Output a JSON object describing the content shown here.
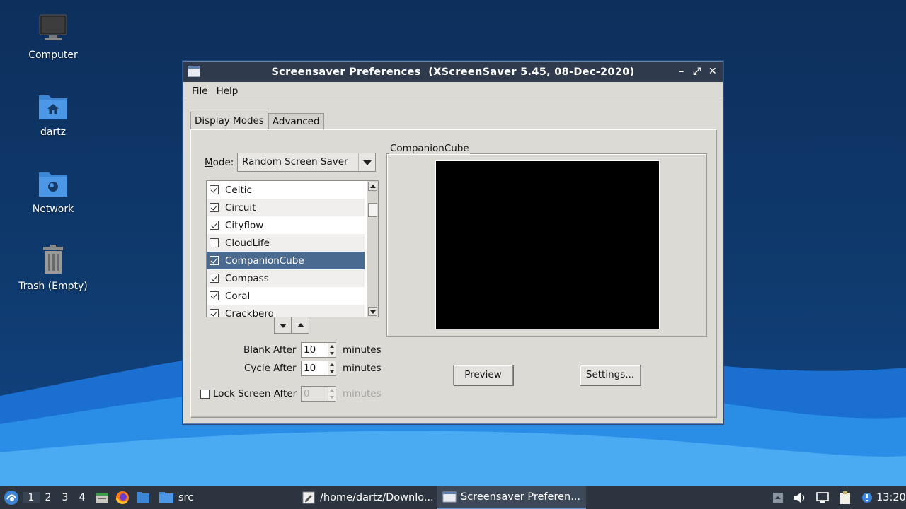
{
  "desktop": {
    "icons": [
      {
        "label": "Computer",
        "icon": "computer-icon"
      },
      {
        "label": "dartz",
        "icon": "home-folder-icon"
      },
      {
        "label": "Network",
        "icon": "network-folder-icon"
      },
      {
        "label": "Trash (Empty)",
        "icon": "trash-icon"
      }
    ]
  },
  "window": {
    "title": "Screensaver Preferences  (XScreenSaver 5.45, 08-Dec-2020)",
    "menu": [
      "File",
      "Help"
    ],
    "tabs": [
      "Display Modes",
      "Advanced"
    ],
    "mode": {
      "label": "Mode:",
      "value": "Random Screen Saver"
    },
    "savers": [
      {
        "name": "Celtic",
        "checked": true
      },
      {
        "name": "Circuit",
        "checked": true
      },
      {
        "name": "Cityflow",
        "checked": true
      },
      {
        "name": "CloudLife",
        "checked": false
      },
      {
        "name": "CompanionCube",
        "checked": true,
        "selected": true
      },
      {
        "name": "Compass",
        "checked": true
      },
      {
        "name": "Coral",
        "checked": true
      },
      {
        "name": "Crackberg",
        "checked": true
      }
    ],
    "blank_after": {
      "label": "Blank After",
      "value": "10",
      "unit": "minutes"
    },
    "cycle_after": {
      "label": "Cycle After",
      "value": "10",
      "unit": "minutes"
    },
    "lock_screen": {
      "label": "Lock Screen After",
      "value": "0",
      "unit": "minutes",
      "checked": false
    },
    "preview": {
      "title": "CompanionCube",
      "preview_button": "Preview",
      "settings_button": "Settings..."
    }
  },
  "taskbar": {
    "workspaces": [
      "1",
      "2",
      "3",
      "4"
    ],
    "active_workspace": "1",
    "quicklaunch": [
      "file-manager-icon",
      "firefox-icon",
      "folder-icon"
    ],
    "folder_label": "src",
    "tasks": [
      {
        "label": "/home/dartz/Downlo...",
        "active": false
      },
      {
        "label": "Screensaver Preferen...",
        "active": true
      }
    ],
    "clock": "13:20"
  }
}
